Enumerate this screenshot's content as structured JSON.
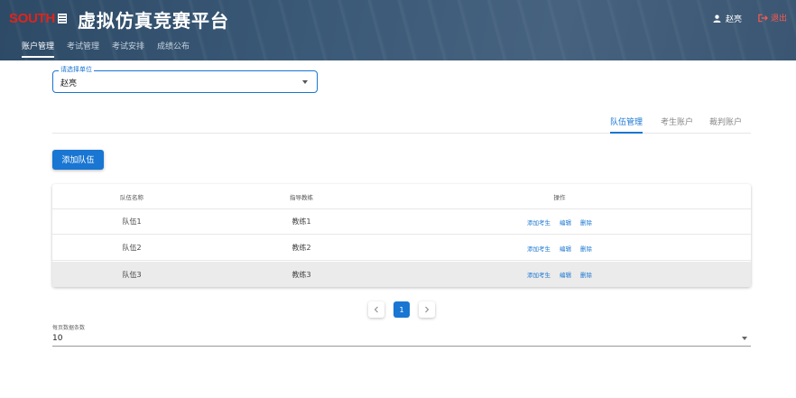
{
  "header": {
    "logo_text": "SOUTH",
    "title": "虚拟仿真竞赛平台",
    "username": "赵亮",
    "logout_label": "退出",
    "colors": {
      "bar": "#3b5a78",
      "logo_red": "#e2231a",
      "logout": "#ff5a4f"
    }
  },
  "nav": {
    "items": [
      {
        "label": "账户管理",
        "active": true
      },
      {
        "label": "考试管理",
        "active": false
      },
      {
        "label": "考试安排",
        "active": false
      },
      {
        "label": "成绩公布",
        "active": false
      }
    ]
  },
  "unit_select": {
    "legend": "请选择单位",
    "value": "赵亮"
  },
  "tabs": [
    {
      "label": "队伍管理",
      "active": true
    },
    {
      "label": "考生账户",
      "active": false
    },
    {
      "label": "裁判账户",
      "active": false
    }
  ],
  "add_team_label": "添加队伍",
  "table": {
    "columns": [
      "队伍名称",
      "指导教练",
      "操作"
    ],
    "rows": [
      {
        "team": "队伍1",
        "coach": "教练1"
      },
      {
        "team": "队伍2",
        "coach": "教练2"
      },
      {
        "team": "队伍3",
        "coach": "教练3"
      }
    ],
    "actions": {
      "add": "添加考生",
      "edit": "编辑",
      "delete": "删除"
    }
  },
  "pagination": {
    "current_page": "1",
    "prev_icon": "chevron-left-icon",
    "next_icon": "chevron-right-icon"
  },
  "rows_per_page": {
    "label": "每页数据条数",
    "value": "10"
  },
  "accent_color": "#1976d2"
}
